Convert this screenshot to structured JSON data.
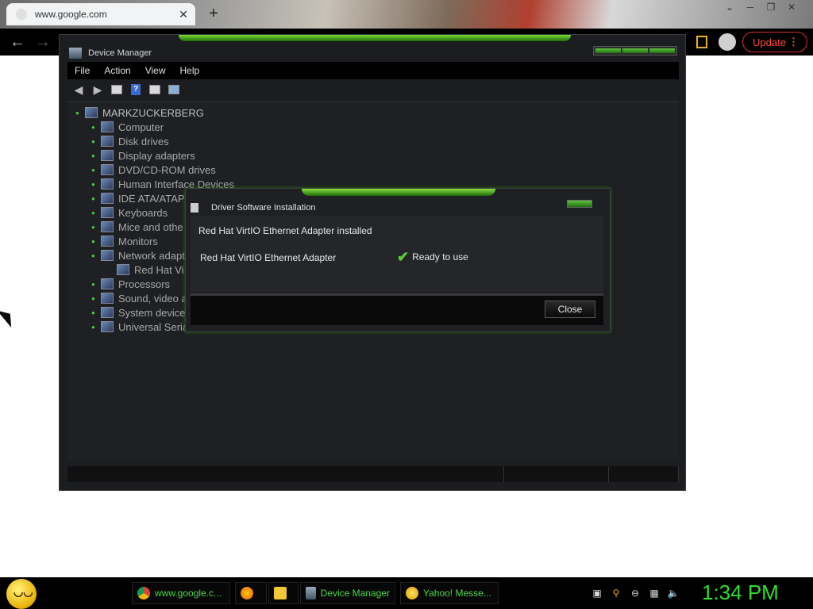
{
  "browser": {
    "tab_title": "www.google.com",
    "tab_close": "✕",
    "new_tab": "+",
    "update_label": "Update",
    "update_menu": "⋮",
    "back_icon": "←",
    "forward_icon": "→"
  },
  "device_manager": {
    "title": "Device Manager",
    "menu": [
      "File",
      "Action",
      "View",
      "Help"
    ],
    "tree": [
      {
        "label": "MARKZUCKERBERG",
        "level": 0,
        "icon": "computer-icon"
      },
      {
        "label": "Computer",
        "level": 1,
        "icon": "monitor-icon"
      },
      {
        "label": "Disk drives",
        "level": 1,
        "icon": "disk-icon"
      },
      {
        "label": "Display adapters",
        "level": 1,
        "icon": "display-adapter-icon"
      },
      {
        "label": "DVD/CD-ROM drives",
        "level": 1,
        "icon": "dvd-icon"
      },
      {
        "label": "Human Interface Devices",
        "level": 1,
        "icon": "hid-icon"
      },
      {
        "label": "IDE ATA/ATAP",
        "level": 1,
        "icon": "ide-icon"
      },
      {
        "label": "Keyboards",
        "level": 1,
        "icon": "keyboard-icon"
      },
      {
        "label": "Mice and othe",
        "level": 1,
        "icon": "mouse-icon"
      },
      {
        "label": "Monitors",
        "level": 1,
        "icon": "monitor-icon"
      },
      {
        "label": "Network adapt",
        "level": 1,
        "icon": "network-icon"
      },
      {
        "label": "Red Hat Vi",
        "level": 2,
        "icon": "network-icon"
      },
      {
        "label": "Processors",
        "level": 1,
        "icon": "processor-icon"
      },
      {
        "label": "Sound, video a",
        "level": 1,
        "icon": "sound-icon"
      },
      {
        "label": "System device",
        "level": 1,
        "icon": "system-icon"
      },
      {
        "label": "Universal Seria",
        "level": 1,
        "icon": "usb-icon"
      }
    ]
  },
  "dialog": {
    "title": "Driver Software Installation",
    "heading": "Red Hat VirtIO Ethernet Adapter installed",
    "device": "Red Hat VirtIO Ethernet Adapter",
    "status": "Ready to use",
    "close_label": "Close"
  },
  "taskbar": {
    "items": [
      {
        "label": "www.google.c...",
        "icon": "chrome-icon"
      },
      {
        "label": "",
        "icon": "firefox-icon"
      },
      {
        "label": "",
        "icon": "folder-icon"
      },
      {
        "label": "Device Manager",
        "icon": "device-manager-icon"
      },
      {
        "label": "Yahoo! Messe...",
        "icon": "yahoo-messenger-icon"
      }
    ],
    "clock": "1:34 PM"
  },
  "colors": {
    "accent_green": "#4cd84c",
    "update_red": "#ff4a3d",
    "window_bg": "#1b1d20"
  }
}
